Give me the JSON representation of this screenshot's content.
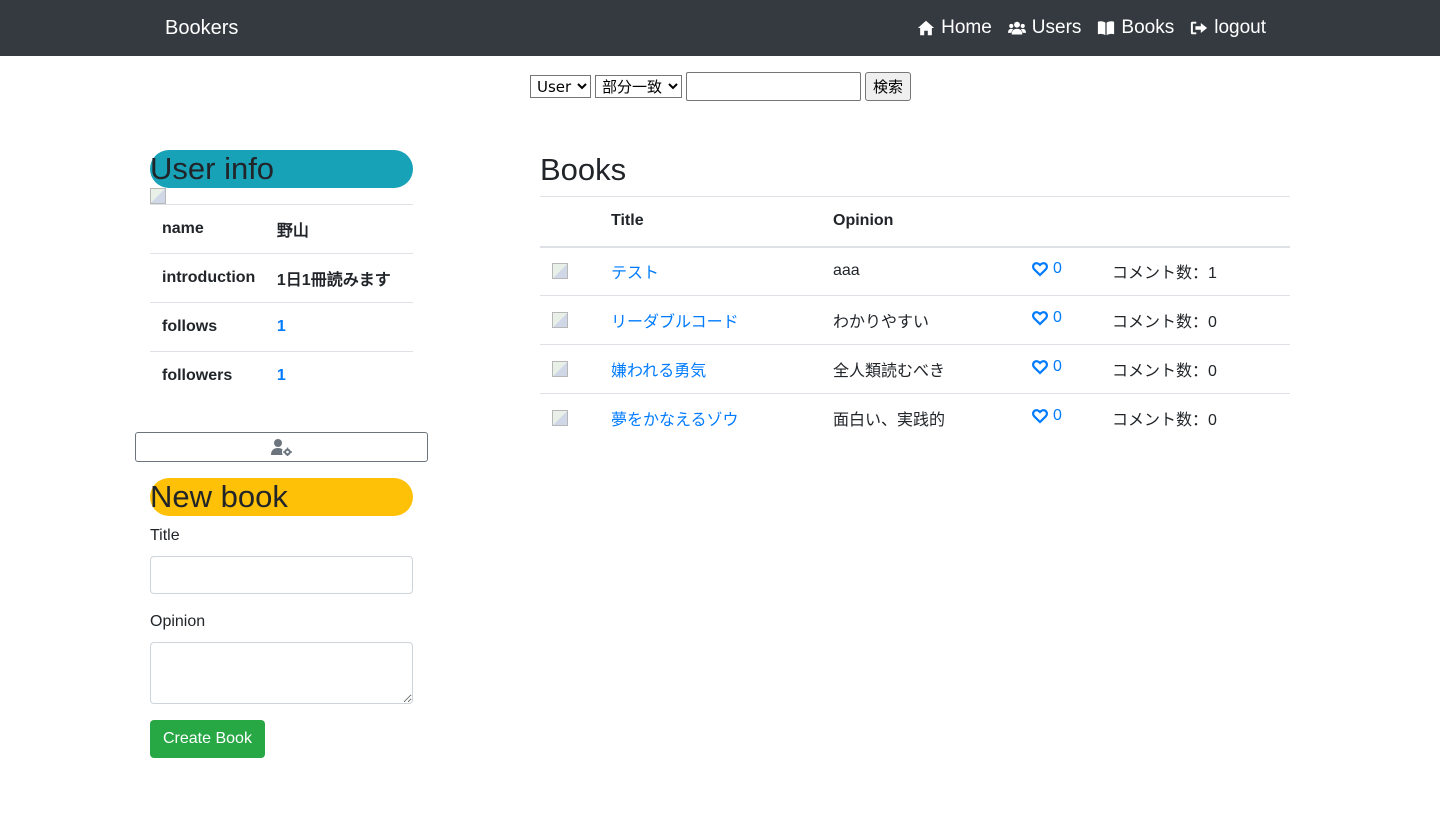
{
  "navbar": {
    "brand": "Bookers",
    "links": [
      {
        "label": "Home",
        "icon": "home-icon"
      },
      {
        "label": "Users",
        "icon": "users-icon"
      },
      {
        "label": "Books",
        "icon": "book-open-icon"
      },
      {
        "label": "logout",
        "icon": "sign-out-icon"
      }
    ]
  },
  "search": {
    "target_selected": "User",
    "method_selected": "部分一致",
    "query": "",
    "button": "検索"
  },
  "user_info": {
    "heading": "User info",
    "rows": [
      {
        "label": "name",
        "value": "野山"
      },
      {
        "label": "introduction",
        "value": "1日1冊読みます"
      },
      {
        "label": "follows",
        "value": "1"
      },
      {
        "label": "followers",
        "value": "1"
      }
    ],
    "edit_icon": "user-cog-icon"
  },
  "new_book": {
    "heading": "New book",
    "title_label": "Title",
    "title_value": "",
    "opinion_label": "Opinion",
    "opinion_value": "",
    "submit": "Create Book"
  },
  "books": {
    "heading": "Books",
    "columns": [
      "",
      "Title",
      "Opinion",
      "",
      ""
    ],
    "rows": [
      {
        "title": "テスト",
        "opinion": "aaa",
        "likes": "0",
        "comments": "コメント数：1"
      },
      {
        "title": "リーダブルコード",
        "opinion": "わかりやすい",
        "likes": "0",
        "comments": "コメント数：0"
      },
      {
        "title": "嫌われる勇気",
        "opinion": "全人類読むべき",
        "likes": "0",
        "comments": "コメント数：0"
      },
      {
        "title": "夢をかなえるゾウ",
        "opinion": "面白い、実践的",
        "likes": "0",
        "comments": "コメント数：0"
      }
    ]
  },
  "colors": {
    "navbar": "#343a40",
    "user_info_pill": "#17a2b8",
    "new_book_pill": "#ffc107",
    "link": "#007bff",
    "create_button": "#28a745"
  }
}
